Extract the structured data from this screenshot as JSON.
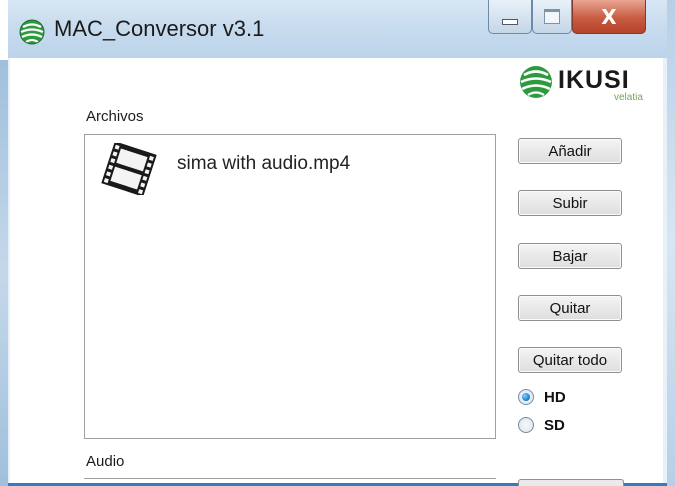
{
  "window": {
    "title": "MAC_Conversor v3.1",
    "icon": "app-globe-icon",
    "controls": {
      "minimize": "minimize-icon",
      "maximize": "maximize-icon",
      "close_label": "X"
    }
  },
  "logo": {
    "word": "IKUSI",
    "sub": "velatia",
    "icon": "ikusi-globe-icon"
  },
  "files": {
    "label": "Archivos",
    "items": [
      {
        "name": "sima with audio.mp4",
        "icon": "film-icon"
      }
    ]
  },
  "buttons": {
    "add": "Añadir",
    "up": "Subir",
    "down": "Bajar",
    "remove": "Quitar",
    "remove_all": "Quitar todo"
  },
  "quality": {
    "options": [
      "HD",
      "SD"
    ],
    "selected": "HD"
  },
  "audio": {
    "label": "Audio"
  },
  "colors": {
    "accent": "#2d7fc1",
    "titlebar": "#c7dbee",
    "close": "#c75c41"
  }
}
